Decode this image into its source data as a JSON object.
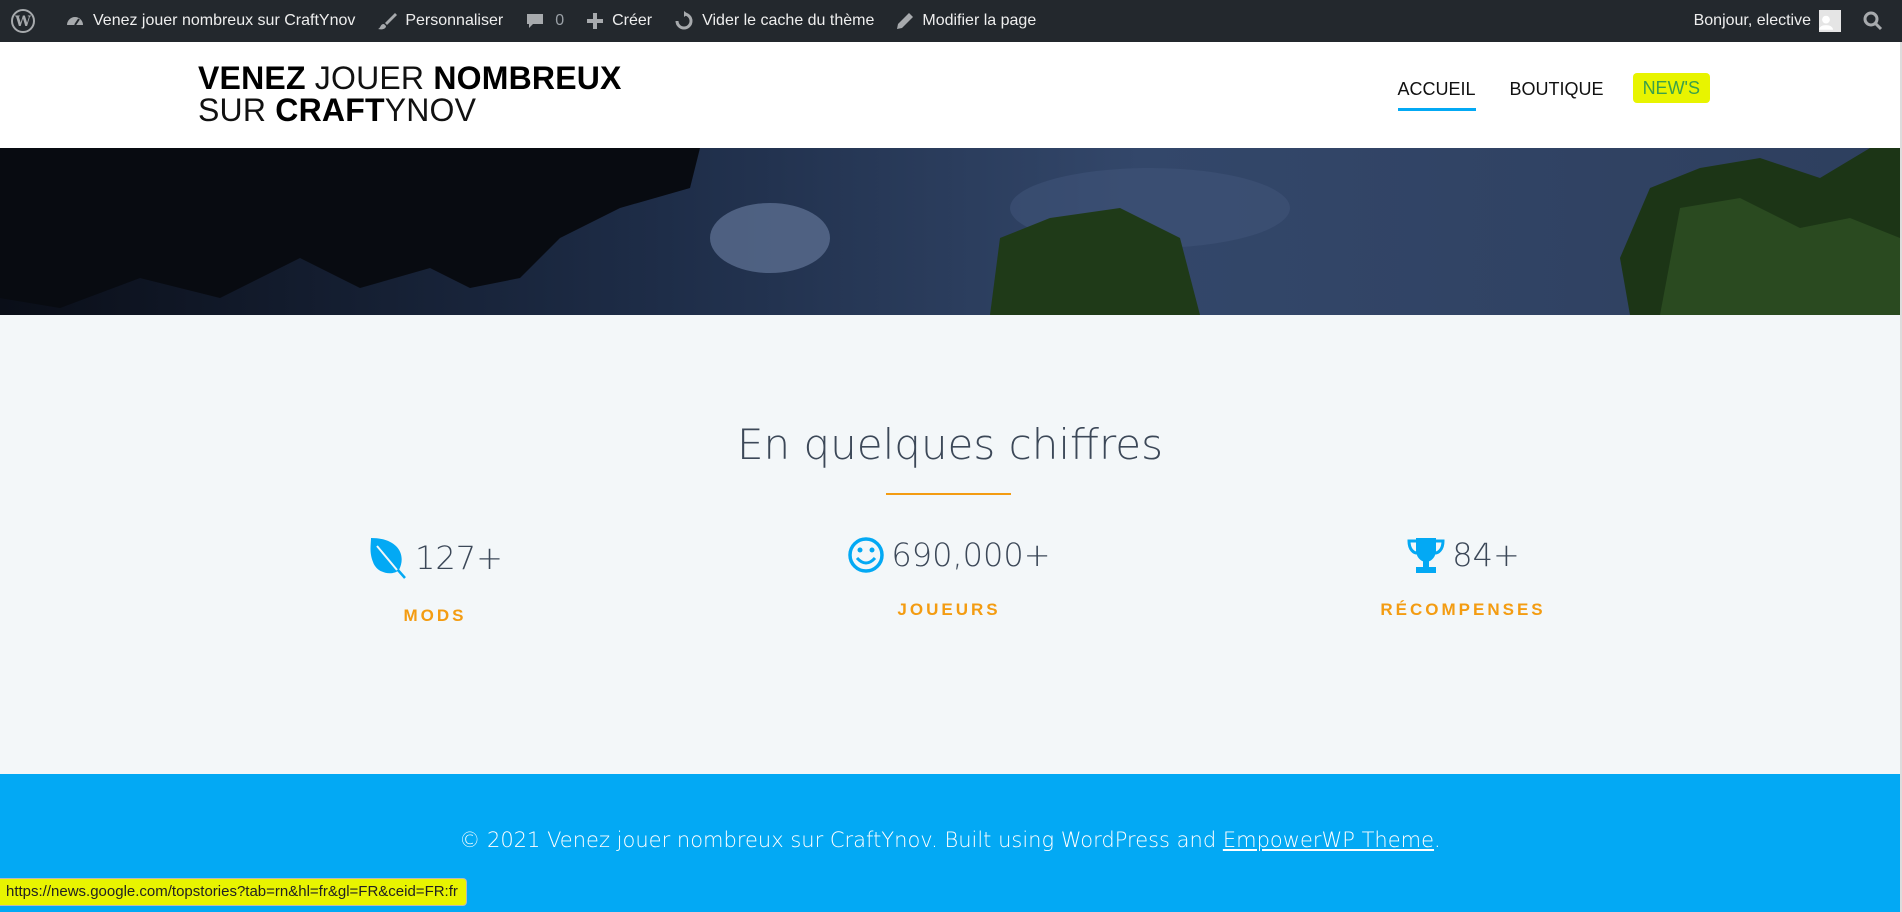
{
  "admin_bar": {
    "site_name": "Venez jouer nombreux sur CraftYnov",
    "customize": "Personnaliser",
    "comments_count": "0",
    "new": "Créer",
    "clear_cache": "Vider le cache du thème",
    "edit_page": "Modifier la page",
    "greeting": "Bonjour, elective"
  },
  "header": {
    "logo_line1_bold1": "VENEZ",
    "logo_line1_light": " JOUER ",
    "logo_line1_bold2": "NOMBREUX",
    "logo_line2_light1": "SUR ",
    "logo_line2_bold": "CRAFT",
    "logo_line2_light2": "YNOV",
    "nav": [
      {
        "label": "ACCUEIL",
        "active": true
      },
      {
        "label": "BOUTIQUE",
        "active": false
      },
      {
        "label": "NEW'S",
        "active": false
      }
    ]
  },
  "counters": {
    "title": "En quelques chiffres",
    "items": [
      {
        "icon": "leaf-icon",
        "value": "127+",
        "label": "MODS"
      },
      {
        "icon": "smile-icon",
        "value": "690,000+",
        "label": "JOUEURS"
      },
      {
        "icon": "trophy-icon",
        "value": "84+",
        "label": "RÉCOMPENSES"
      }
    ]
  },
  "footer": {
    "text": "© 2021 Venez jouer nombreux sur CraftYnov. Built using WordPress and ",
    "link": "EmpowerWP Theme",
    "suffix": "."
  },
  "status_bar": {
    "url": "https://news.google.com/topstories?tab=rn&hl=fr&gl=FR&ceid=FR:fr"
  },
  "colors": {
    "admin_bar": "#23282d",
    "accent": "#03a9f4",
    "orange": "#f39c12",
    "highlight": "#e8f400"
  }
}
